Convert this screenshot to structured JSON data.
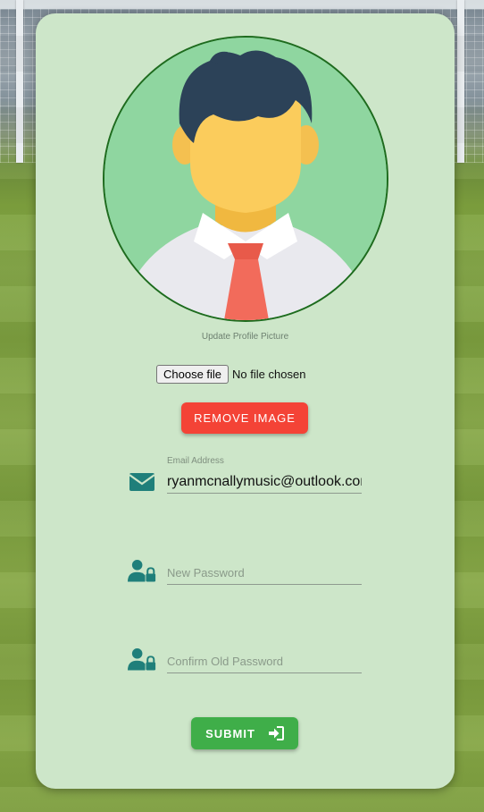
{
  "profile": {
    "update_caption": "Update Profile Picture"
  },
  "file_input": {
    "button_label": "Choose file",
    "status": "No file chosen"
  },
  "remove_button": {
    "label": "REMOVE IMAGE"
  },
  "email": {
    "label": "Email Address",
    "value": "ryanmcnallymusic@outlook.com",
    "icon": "envelope-icon"
  },
  "new_password": {
    "placeholder": "New Password",
    "icon": "user-lock-icon"
  },
  "confirm_password": {
    "placeholder": "Confirm Old Password",
    "icon": "user-lock-icon"
  },
  "submit_button": {
    "label": "SUBMIT",
    "icon": "sign-in-icon"
  },
  "colors": {
    "card_background": "#cde6c9",
    "icon_teal": "#1f7f7a",
    "remove_red": "#f44336",
    "submit_green": "#3fae49",
    "avatar_border": "#1e6b1e"
  }
}
